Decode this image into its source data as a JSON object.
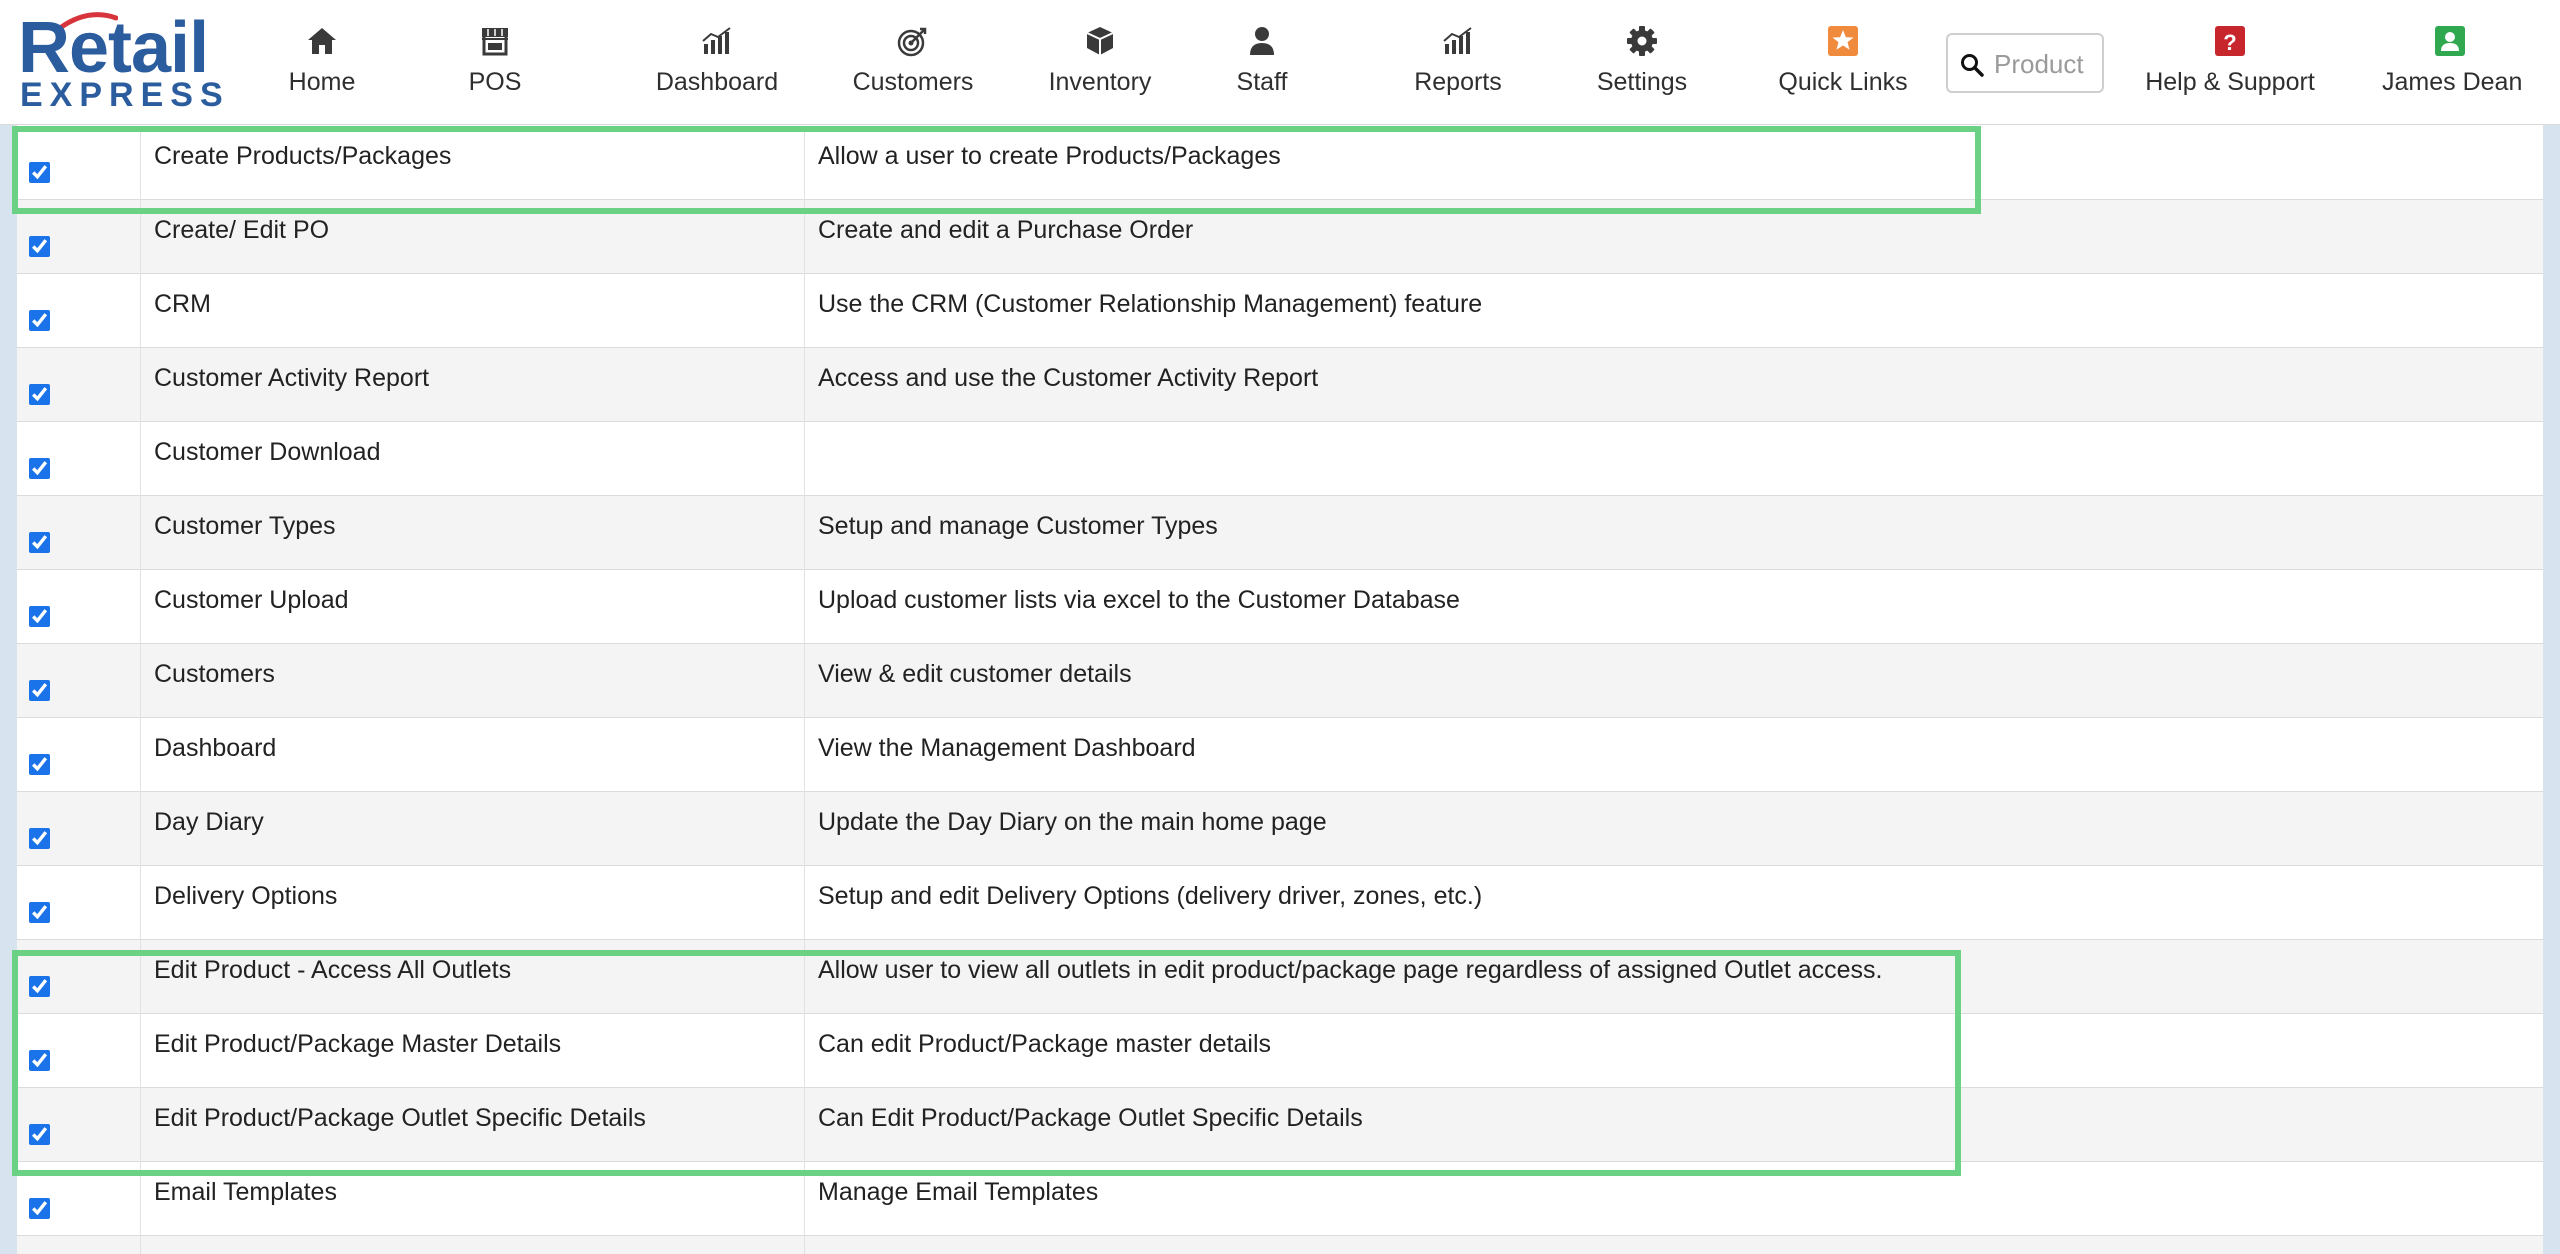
{
  "brand": {
    "line1": "Retail",
    "line2": "EXPRESS"
  },
  "nav": [
    {
      "key": "home",
      "label": "Home",
      "icon": "home-icon"
    },
    {
      "key": "pos",
      "label": "POS",
      "icon": "store-icon"
    },
    {
      "key": "dashboard",
      "label": "Dashboard",
      "icon": "bar-chart-icon"
    },
    {
      "key": "customers",
      "label": "Customers",
      "icon": "target-icon"
    },
    {
      "key": "inventory",
      "label": "Inventory",
      "icon": "box-icon"
    },
    {
      "key": "staff",
      "label": "Staff",
      "icon": "person-icon"
    },
    {
      "key": "reports",
      "label": "Reports",
      "icon": "bar-chart-icon"
    },
    {
      "key": "settings",
      "label": "Settings",
      "icon": "gear-icon"
    },
    {
      "key": "quicklinks",
      "label": "Quick Links",
      "icon": "star-icon"
    },
    {
      "key": "help",
      "label": "Help & Support",
      "icon": "question-icon"
    },
    {
      "key": "user",
      "label": "James Dean",
      "icon": "user-icon"
    }
  ],
  "search": {
    "placeholder": "Product",
    "value": ""
  },
  "colors": {
    "brand": "#2b5c9e",
    "highlight": "#6bd184",
    "checkbox": "#1a73e8",
    "quicklinks": "#f08a3c",
    "help": "#c8262d",
    "user": "#2fa84f"
  },
  "permissions": [
    {
      "name": "Create Products/Packages",
      "description": "Allow a user to create Products/Packages",
      "checked": true
    },
    {
      "name": "Create/ Edit PO",
      "description": "Create and edit a Purchase Order",
      "checked": true
    },
    {
      "name": "CRM",
      "description": "Use the CRM (Customer Relationship Management) feature",
      "checked": true
    },
    {
      "name": "Customer Activity Report",
      "description": "Access and use the Customer Activity Report",
      "checked": true
    },
    {
      "name": "Customer Download",
      "description": "",
      "checked": true
    },
    {
      "name": "Customer Types",
      "description": "Setup and manage Customer Types",
      "checked": true
    },
    {
      "name": "Customer Upload",
      "description": "Upload customer lists via excel to the Customer Database",
      "checked": true
    },
    {
      "name": "Customers",
      "description": "View & edit customer details",
      "checked": true
    },
    {
      "name": "Dashboard",
      "description": "View the Management Dashboard",
      "checked": true
    },
    {
      "name": "Day Diary",
      "description": "Update the Day Diary on the main home page",
      "checked": true
    },
    {
      "name": "Delivery Options",
      "description": "Setup and edit Delivery Options (delivery driver, zones, etc.)",
      "checked": true
    },
    {
      "name": "Edit Product - Access All Outlets",
      "description": "Allow user to view all outlets in edit product/package page regardless of assigned Outlet access.",
      "checked": true
    },
    {
      "name": "Edit Product/Package Master Details",
      "description": "Can edit Product/Package master details",
      "checked": true
    },
    {
      "name": "Edit Product/Package Outlet Specific Details",
      "description": "Can Edit Product/Package Outlet Specific Details",
      "checked": true
    },
    {
      "name": "Email Templates",
      "description": "Manage Email Templates",
      "checked": true
    },
    {
      "name": "",
      "description": "",
      "checked": true
    }
  ]
}
